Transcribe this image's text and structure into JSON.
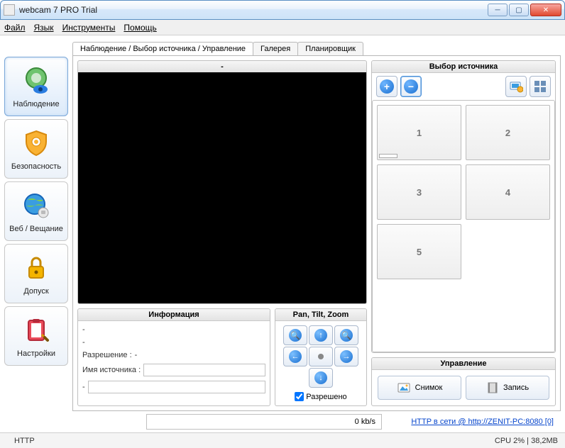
{
  "window": {
    "title": "webcam 7 PRO Trial"
  },
  "menu": {
    "file": "Файл",
    "lang": "Язык",
    "tools": "Инструменты",
    "help": "Помощь"
  },
  "nav": {
    "items": [
      {
        "label": "Наблюдение"
      },
      {
        "label": "Безопасность"
      },
      {
        "label": "Веб / Вещание"
      },
      {
        "label": "Допуск"
      },
      {
        "label": "Настройки"
      }
    ]
  },
  "tabs": {
    "main": "Наблюдение / Выбор источника / Управление",
    "gallery": "Галерея",
    "scheduler": "Планировщик"
  },
  "video": {
    "title": "-"
  },
  "source": {
    "title": "Выбор источника",
    "cells": [
      "1",
      "2",
      "3",
      "4",
      "5"
    ]
  },
  "info": {
    "title": "Информация",
    "line1": "-",
    "line2": "-",
    "res_label": "Разрешение :",
    "res_value": "-",
    "name_label": "Имя источника :",
    "name_value": "",
    "line3": "-",
    "line3_value": ""
  },
  "ptz": {
    "title": "Pan, Tilt, Zoom",
    "allowed": "Разрешено"
  },
  "mgmt": {
    "title": "Управление",
    "snapshot": "Снимок",
    "record": "Запись"
  },
  "bottom": {
    "rate": "0 kb/s",
    "link": "HTTP в сети @ http://ZENIT-PC:8080 [0]"
  },
  "status": {
    "left": "HTTP",
    "cpu": "CPU 2%",
    "mem": "38,2MB"
  }
}
